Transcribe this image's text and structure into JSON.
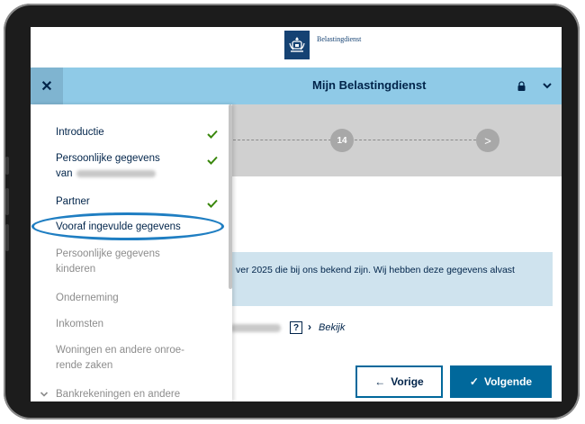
{
  "app": {
    "brand": "Belastingdienst",
    "title": "Mijn Belastingdienst"
  },
  "stepper": {
    "current_step": "14",
    "next_glyph": ">"
  },
  "nav": {
    "items": [
      {
        "label": "Introductie",
        "state": "completed"
      },
      {
        "label": "Persoonlijke gegevens",
        "label_line2": "van",
        "state": "completed"
      },
      {
        "label": "Partner",
        "state": "completed"
      },
      {
        "label": "Vooraf ingevulde gegevens",
        "state": "current"
      },
      {
        "label": "Persoonlijke gegevens",
        "label_line2": "kinderen",
        "state": "disabled"
      },
      {
        "label": "Onderneming",
        "state": "disabled"
      },
      {
        "label": "Inkomsten",
        "state": "disabled"
      },
      {
        "label": "Woningen en andere onroe-",
        "label_line2": "rende zaken",
        "state": "disabled"
      },
      {
        "label": "Bankrekeningen en andere",
        "state": "disabled"
      }
    ]
  },
  "content": {
    "info_text": "ver 2025 die bij ons bekend zijn. Wij hebben deze gegevens alvast",
    "help_glyph": "?",
    "link_label": "Bekijk"
  },
  "buttons": {
    "prev_label": "Vorige",
    "next_label": "Volgende"
  },
  "colors": {
    "topbar": "#8fcae7",
    "primary": "#01689b",
    "text_dark": "#01244a",
    "check_green": "#39870c",
    "highlight_ring": "#1f7ec2"
  }
}
